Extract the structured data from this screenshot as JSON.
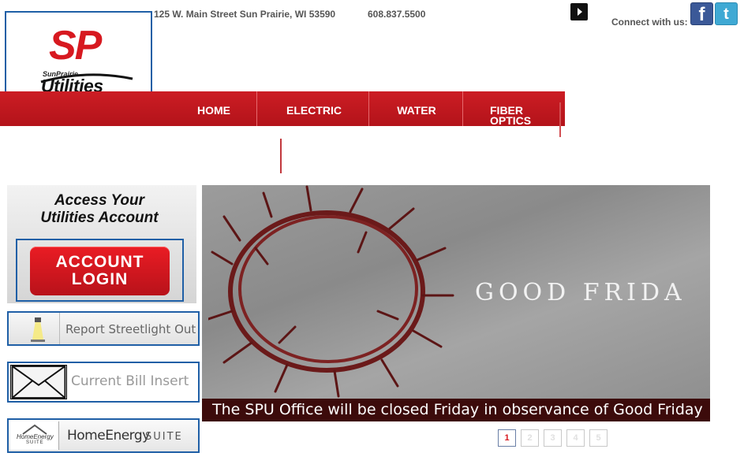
{
  "header": {
    "logo": {
      "sp_text": "SP",
      "small_text": "SunPrairie",
      "utilities_text": "Utilities"
    },
    "address": "125 W. Main Street Sun Prairie, WI 53590",
    "phone": "608.837.5500",
    "connect_label": "Connect with us:",
    "social": {
      "facebook_glyph": "f",
      "twitter_glyph": "t"
    }
  },
  "nav": {
    "items": [
      {
        "label": "HOME"
      },
      {
        "label": "ELECTRIC"
      },
      {
        "label": "WATER"
      },
      {
        "label": "FIBER"
      }
    ],
    "fiber_line2": "OPTICS"
  },
  "sidebar": {
    "access_title_line1": "Access Your",
    "access_title_line2": "Utilities Account",
    "login_line1": "ACCOUNT",
    "login_line2": "LOGIN",
    "streetlight_label": "Report Streetlight Out",
    "bill_insert_label": "Current Bill Insert",
    "home_energy_icon_line1": "HomeEnergy",
    "home_energy_icon_line2": "SUITE",
    "home_energy_main": "HomeEnergy",
    "home_energy_suite": "SUITE"
  },
  "slider": {
    "title": "GOOD FRIDA",
    "caption": "The SPU Office will be closed Friday in observance of Good Friday",
    "pages": [
      "1",
      "2",
      "3",
      "4",
      "5"
    ],
    "active_page": "1"
  },
  "colors": {
    "brand_red": "#d71920",
    "nav_red": "#c4161d",
    "frame_blue": "#1f5fa6",
    "caption_bg": "#3c0b0b",
    "facebook": "#3b5998",
    "twitter": "#3fa9d4"
  },
  "icons": {
    "play": "play-icon",
    "facebook": "facebook-icon",
    "twitter": "twitter-icon",
    "lamp": "streetlight-icon",
    "envelope": "envelope-icon",
    "home_energy": "home-energy-logo-icon"
  }
}
